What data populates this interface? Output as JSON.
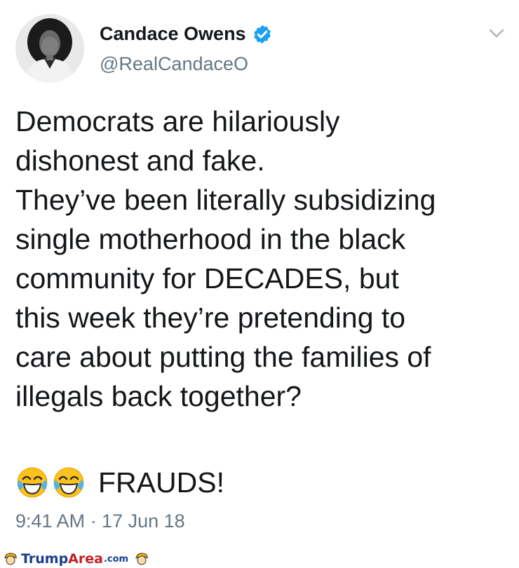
{
  "tweet": {
    "display_name": "Candace Owens",
    "handle": "@RealCandaceO",
    "text": "Democrats are hilariously\ndishonest and fake.\nThey’ve been literally subsidizing\nsingle motherhood in the black\ncommunity for DECADES, but\nthis week they’re pretending to\ncare about putting the families of\nillegals back together?",
    "reaction_text": "FRAUDS!",
    "reaction_emoji": [
      "face-with-tears-of-joy",
      "face-with-tears-of-joy"
    ],
    "timestamp": "9:41 AM · 17 Jun 18"
  },
  "icons": {
    "verified": "verified-badge-icon",
    "menu": "chevron-down-icon"
  },
  "watermark": {
    "part1": "Trump",
    "part2": "Area",
    "part3": ".com"
  },
  "colors": {
    "verified_blue": "#1da1f2",
    "secondary_text": "#657786",
    "primary_text": "#14171a",
    "watermark_blue": "#1a3d8c",
    "watermark_red": "#c42126"
  }
}
